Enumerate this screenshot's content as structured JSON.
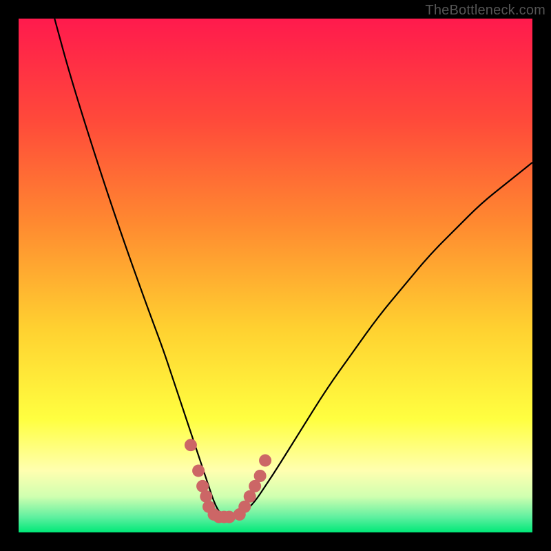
{
  "watermark": "TheBottleneck.com",
  "chart_data": {
    "type": "line",
    "title": "",
    "xlabel": "",
    "ylabel": "",
    "xlim": [
      0,
      100
    ],
    "ylim": [
      0,
      100
    ],
    "grid": false,
    "legend": false,
    "series": [
      {
        "name": "curve",
        "color": "#000000",
        "x": [
          7,
          10,
          15,
          20,
          25,
          28,
          30,
          32,
          34,
          36,
          37,
          38,
          39,
          40,
          42,
          44,
          46,
          48,
          50,
          55,
          60,
          65,
          70,
          75,
          80,
          85,
          90,
          95,
          100
        ],
        "y": [
          100,
          89,
          73,
          58,
          44,
          36,
          30,
          24,
          18,
          12,
          9,
          6,
          4,
          3,
          3,
          4,
          6,
          9,
          12,
          20,
          28,
          35,
          42,
          48,
          54,
          59,
          64,
          68,
          72
        ]
      },
      {
        "name": "flat-dots-left",
        "type": "scatter",
        "color": "#CC6666",
        "x": [
          33.5,
          35.0,
          35.8,
          36.5,
          37.0,
          38.0,
          39.0,
          40.0,
          41.0
        ],
        "y": [
          17,
          12,
          9,
          7,
          5,
          3.5,
          3,
          3,
          3
        ]
      },
      {
        "name": "flat-dots-right",
        "type": "scatter",
        "color": "#CC6666",
        "x": [
          43.0,
          44.0,
          45.0,
          46.0,
          47.0,
          48.0
        ],
        "y": [
          3.5,
          5,
          7,
          9,
          11,
          14
        ]
      }
    ],
    "background_gradient": {
      "stops": [
        {
          "pos": 0.0,
          "color": "#FF1A4D"
        },
        {
          "pos": 0.2,
          "color": "#FF4A3A"
        },
        {
          "pos": 0.4,
          "color": "#FF8A30"
        },
        {
          "pos": 0.6,
          "color": "#FFD030"
        },
        {
          "pos": 0.78,
          "color": "#FFFF40"
        },
        {
          "pos": 0.88,
          "color": "#FFFFB0"
        },
        {
          "pos": 0.93,
          "color": "#D0FFB0"
        },
        {
          "pos": 0.97,
          "color": "#60F0A0"
        },
        {
          "pos": 1.0,
          "color": "#00E878"
        }
      ]
    }
  }
}
